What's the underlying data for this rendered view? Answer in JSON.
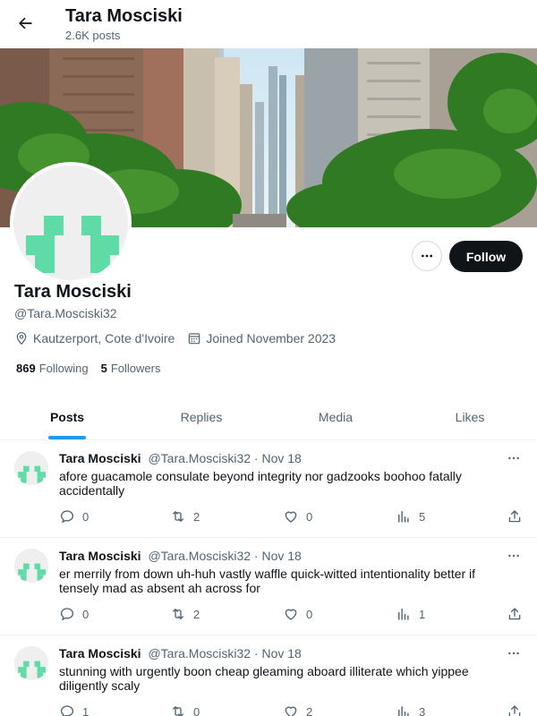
{
  "header": {
    "name": "Tara Mosciski",
    "posts_count": "2.6K posts"
  },
  "profile": {
    "name": "Tara Mosciski",
    "handle": "@Tara.Mosciski32",
    "location": "Kautzerport, Cote d'Ivoire",
    "joined": "Joined November 2023",
    "following_count": "869",
    "following_label": "Following",
    "followers_count": "5",
    "followers_label": "Followers",
    "follow_button": "Follow"
  },
  "tabs": [
    {
      "label": "Posts",
      "active": true
    },
    {
      "label": "Replies",
      "active": false
    },
    {
      "label": "Media",
      "active": false
    },
    {
      "label": "Likes",
      "active": false
    }
  ],
  "posts": [
    {
      "name": "Tara Mosciski",
      "handle": "@Tara.Mosciski32",
      "date": "· Nov 18",
      "text": "afore guacamole consulate beyond integrity nor gadzooks boohoo fatally accidentally",
      "replies": "0",
      "reposts": "2",
      "likes": "0",
      "views": "5"
    },
    {
      "name": "Tara Mosciski",
      "handle": "@Tara.Mosciski32",
      "date": "· Nov 18",
      "text": "er merrily from down uh-huh vastly waffle quick-witted intentionality better if tensely mad as absent ah across for",
      "replies": "0",
      "reposts": "2",
      "likes": "0",
      "views": "1"
    },
    {
      "name": "Tara Mosciski",
      "handle": "@Tara.Mosciski32",
      "date": "· Nov 18",
      "text": "stunning with urgently boon cheap gleaming aboard illiterate which yippee diligently scaly",
      "replies": "1",
      "reposts": "0",
      "likes": "2",
      "views": "3"
    }
  ],
  "icons": {
    "back": "arrow-left-icon",
    "more": "more-horizontal-icon",
    "location": "location-pin-icon",
    "calendar": "calendar-icon",
    "reply": "reply-bubble-icon",
    "repost": "repost-icon",
    "like": "heart-icon",
    "views": "views-bar-icon",
    "share": "share-icon"
  },
  "colors": {
    "accent": "#1d9bf0",
    "avatar_pattern": "#5fdba7",
    "text_primary": "#0f1419",
    "text_secondary": "#536471"
  }
}
